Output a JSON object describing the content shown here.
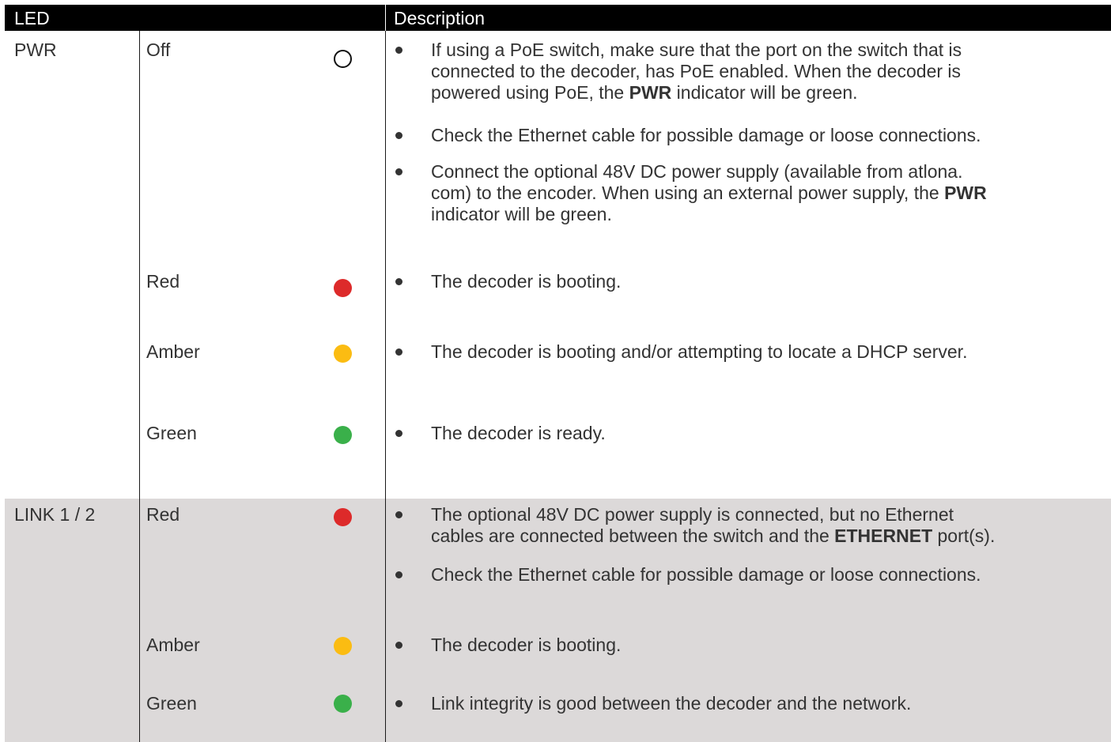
{
  "header": {
    "led": "LED",
    "description": "Description"
  },
  "colors": {
    "red": "#dd2a2a",
    "amber": "#fbbc12",
    "green": "#3ab04a",
    "off": "#ffffff",
    "shade": "#dcd9d9"
  },
  "groups": [
    {
      "label": "PWR",
      "states": [
        {
          "state": "Off",
          "led": "off",
          "descriptions": [
            [
              "If using a PoE switch, make sure that the port on the switch that is",
              "connected to the decoder, has PoE enabled.  When the decoder is",
              "powered using PoE, the ",
              "PWR",
              " indicator will be green."
            ],
            [
              "Check the Ethernet cable for possible damage or loose connections."
            ],
            [
              "Connect the optional 48V DC power supply (available from atlona.",
              "com) to the encoder.  When using an external power supply, the ",
              "PWR",
              "indicator will be green."
            ]
          ]
        },
        {
          "state": "Red",
          "led": "red",
          "descriptions": [
            [
              "The decoder is booting."
            ]
          ]
        },
        {
          "state": "Amber",
          "led": "amber",
          "descriptions": [
            [
              "The decoder is booting and/or attempting to locate a DHCP server."
            ]
          ]
        },
        {
          "state": "Green",
          "led": "green",
          "descriptions": [
            [
              "The decoder is ready."
            ]
          ]
        }
      ]
    },
    {
      "label": "LINK 1 / 2",
      "states": [
        {
          "state": "Red",
          "led": "red",
          "descriptions": [
            [
              "The optional 48V DC power supply is connected, but no Ethernet",
              "cables are connected between the switch and the ",
              "ETHERNET",
              " port(s)."
            ],
            [
              "Check the Ethernet cable for possible damage or loose connections."
            ]
          ]
        },
        {
          "state": "Amber",
          "led": "amber",
          "descriptions": [
            [
              "The decoder is booting."
            ]
          ]
        },
        {
          "state": "Green",
          "led": "green",
          "descriptions": [
            [
              "Link integrity is good between the decoder and the network."
            ]
          ]
        }
      ]
    }
  ]
}
